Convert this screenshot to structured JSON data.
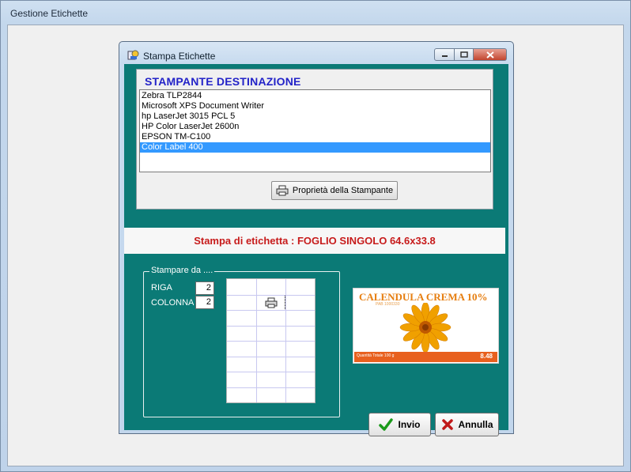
{
  "outer_window": {
    "title": "Gestione Etichette"
  },
  "dialog": {
    "title": "Stampa Etichette",
    "printer_section": {
      "header": "STAMPANTE DESTINAZIONE",
      "printers": [
        "Zebra  TLP2844",
        "Microsoft XPS Document Writer",
        "hp LaserJet 3015 PCL 5",
        "HP Color LaserJet 2600n",
        "EPSON TM-C100",
        "Color Label 400"
      ],
      "selected_printer": "Color Label 400",
      "properties_button": "Proprietà della Stampante"
    },
    "label_info": "Stampa di etichetta : FOGLIO SINGOLO 64.6x33.8",
    "start_group": {
      "legend": "Stampare da ....",
      "row_label": "RIGA",
      "row_value": "2",
      "col_label": "COLONNA",
      "col_value": "2",
      "grid": {
        "columns": 3,
        "rows": 8,
        "selected_row": 2,
        "selected_col": 2
      }
    },
    "preview": {
      "title": "CALENDULA CREMA 10%",
      "subtitle": "PAB 1000330",
      "footer_left": "Quantità Totale 100 g",
      "footer_price": "8.48",
      "colors": {
        "title": "#e67e10",
        "bar": "#e8601e",
        "flower": "#f0a000"
      }
    },
    "buttons": {
      "ok": "Invio",
      "cancel": "Annulla"
    }
  }
}
